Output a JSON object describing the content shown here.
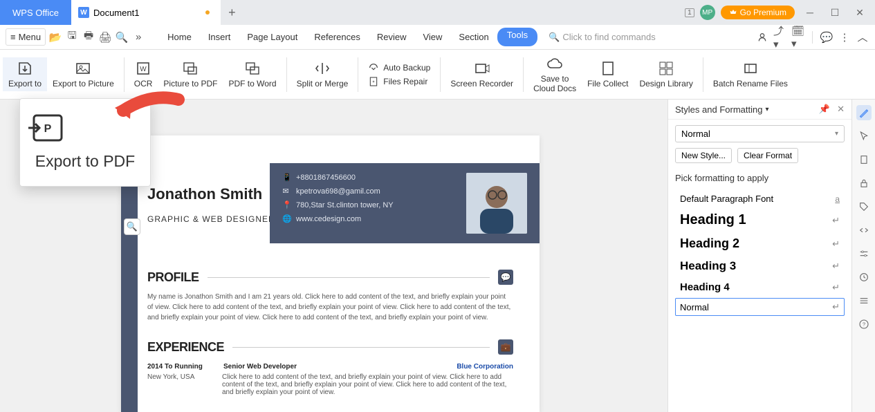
{
  "title": {
    "app": "WPS Office",
    "doc": "Document1"
  },
  "premium": "Go Premium",
  "avatar": "MP",
  "window_badge": "1",
  "menu_label": "Menu",
  "menu_tabs": [
    "Home",
    "Insert",
    "Page Layout",
    "References",
    "Review",
    "View",
    "Section",
    "Tools"
  ],
  "search_placeholder": "Click to find commands",
  "ribbon": {
    "export_to": "Export to",
    "export_picture": "Export to Picture",
    "ocr": "OCR",
    "picture_pdf": "Picture to PDF",
    "pdf_word": "PDF to Word",
    "split_merge": "Split or Merge",
    "auto_backup": "Auto Backup",
    "files_repair": "Files Repair",
    "screen_recorder": "Screen Recorder",
    "save_cloud_l1": "Save to",
    "save_cloud_l2": "Cloud Docs",
    "file_collect": "File Collect",
    "design_library": "Design Library",
    "batch_rename": "Batch Rename Files"
  },
  "callout": {
    "label": "Export to PDF"
  },
  "document": {
    "name": "Jonathon Smith",
    "subtitle": "GRAPHIC & WEB DESIGNER",
    "phone": "+8801867456600",
    "email": "kpetrova698@gamil.com",
    "address": "780,Star St.clinton tower, NY",
    "website": "www.cedesign.com",
    "profile_title": "PROFILE",
    "profile_body": "My name is Jonathon Smith and I am 21 years old. Click here to add content of the text, and briefly explain your point of view. Click here to add content of the text, and briefly explain your point of view. Click here to add content of the text, and briefly explain your point of view. Click here to add content of the text, and briefly explain your point of view.",
    "experience_title": "EXPERIENCE",
    "exp_period": "2014 To Running",
    "exp_role": "Senior Web Developer",
    "exp_company": "Blue Corporation",
    "exp_location": "New York, USA",
    "exp_desc": "Click here to add content of the text, and briefly explain your point of view. Click here to add content of the text, and briefly explain your point of view. Click here to add content of the text, and briefly explain your point of view."
  },
  "panel": {
    "title": "Styles and Formatting",
    "current": "Normal",
    "new_style": "New Style...",
    "clear_format": "Clear Format",
    "pick_label": "Pick formatting to apply",
    "styles": {
      "default_font": "Default Paragraph Font",
      "h1": "Heading 1",
      "h2": "Heading 2",
      "h3": "Heading 3",
      "h4": "Heading 4",
      "normal": "Normal"
    }
  }
}
